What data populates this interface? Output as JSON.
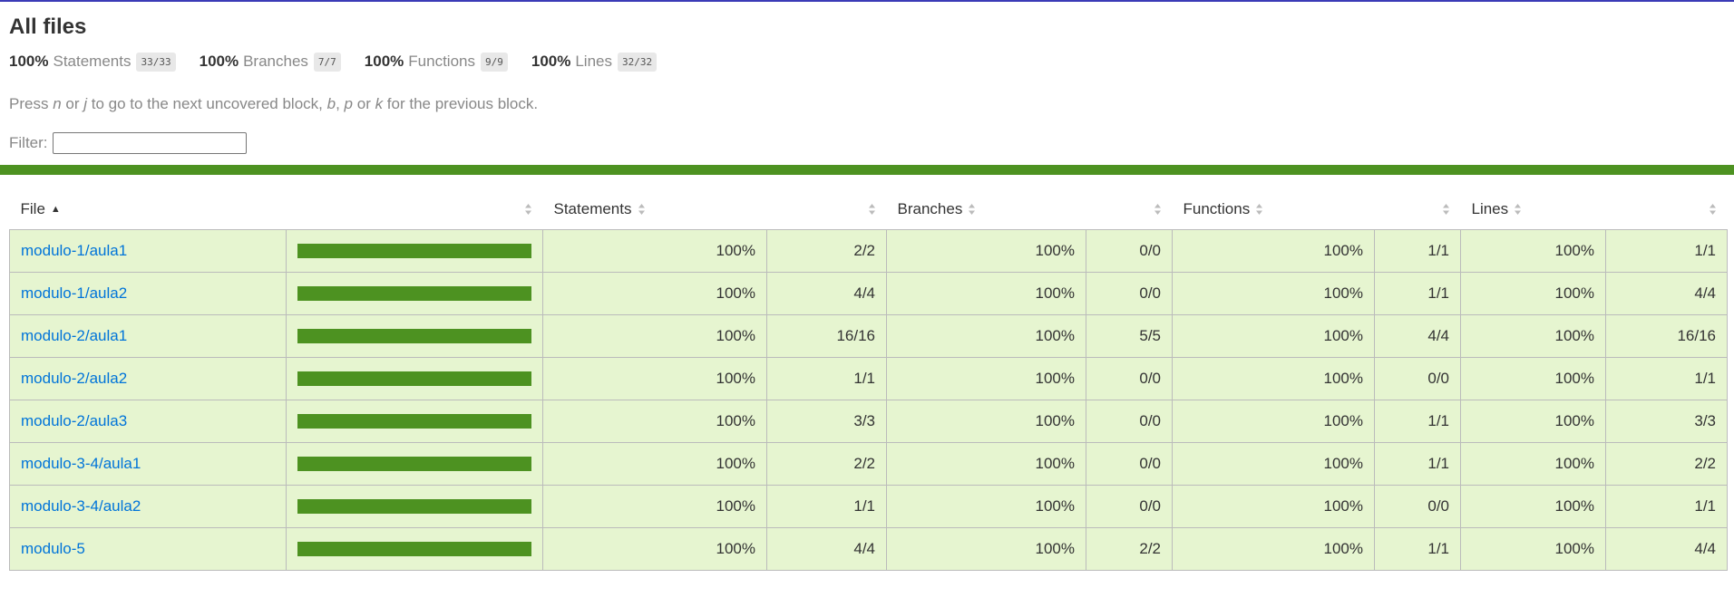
{
  "title": "All files",
  "summary": [
    {
      "pct": "100%",
      "label": "Statements",
      "fraction": "33/33"
    },
    {
      "pct": "100%",
      "label": "Branches",
      "fraction": "7/7"
    },
    {
      "pct": "100%",
      "label": "Functions",
      "fraction": "9/9"
    },
    {
      "pct": "100%",
      "label": "Lines",
      "fraction": "32/32"
    }
  ],
  "hint": {
    "press": "Press ",
    "key_n": "n",
    "or1": " or ",
    "key_j": "j",
    "middle": " to go to the next uncovered block, ",
    "key_b": "b",
    "comma": ", ",
    "key_p": "p",
    "or2": " or ",
    "key_k": "k",
    "end": " for the previous block."
  },
  "filter": {
    "label": "Filter:",
    "value": ""
  },
  "colors": {
    "status_bar": "#4d9221",
    "row_bg": "#e6f5d0",
    "link": "#0074d9"
  },
  "table": {
    "headers": {
      "file": "File",
      "statements": "Statements",
      "branches": "Branches",
      "functions": "Functions",
      "lines": "Lines"
    },
    "rows": [
      {
        "file": "modulo-1/aula1",
        "coverage": 1.0,
        "stmt_pct": "100%",
        "stmt_frac": "2/2",
        "br_pct": "100%",
        "br_frac": "0/0",
        "fn_pct": "100%",
        "fn_frac": "1/1",
        "ln_pct": "100%",
        "ln_frac": "1/1"
      },
      {
        "file": "modulo-1/aula2",
        "coverage": 1.0,
        "stmt_pct": "100%",
        "stmt_frac": "4/4",
        "br_pct": "100%",
        "br_frac": "0/0",
        "fn_pct": "100%",
        "fn_frac": "1/1",
        "ln_pct": "100%",
        "ln_frac": "4/4"
      },
      {
        "file": "modulo-2/aula1",
        "coverage": 1.0,
        "stmt_pct": "100%",
        "stmt_frac": "16/16",
        "br_pct": "100%",
        "br_frac": "5/5",
        "fn_pct": "100%",
        "fn_frac": "4/4",
        "ln_pct": "100%",
        "ln_frac": "16/16"
      },
      {
        "file": "modulo-2/aula2",
        "coverage": 1.0,
        "stmt_pct": "100%",
        "stmt_frac": "1/1",
        "br_pct": "100%",
        "br_frac": "0/0",
        "fn_pct": "100%",
        "fn_frac": "0/0",
        "ln_pct": "100%",
        "ln_frac": "1/1"
      },
      {
        "file": "modulo-2/aula3",
        "coverage": 1.0,
        "stmt_pct": "100%",
        "stmt_frac": "3/3",
        "br_pct": "100%",
        "br_frac": "0/0",
        "fn_pct": "100%",
        "fn_frac": "1/1",
        "ln_pct": "100%",
        "ln_frac": "3/3"
      },
      {
        "file": "modulo-3-4/aula1",
        "coverage": 1.0,
        "stmt_pct": "100%",
        "stmt_frac": "2/2",
        "br_pct": "100%",
        "br_frac": "0/0",
        "fn_pct": "100%",
        "fn_frac": "1/1",
        "ln_pct": "100%",
        "ln_frac": "2/2"
      },
      {
        "file": "modulo-3-4/aula2",
        "coverage": 1.0,
        "stmt_pct": "100%",
        "stmt_frac": "1/1",
        "br_pct": "100%",
        "br_frac": "0/0",
        "fn_pct": "100%",
        "fn_frac": "0/0",
        "ln_pct": "100%",
        "ln_frac": "1/1"
      },
      {
        "file": "modulo-5",
        "coverage": 1.0,
        "stmt_pct": "100%",
        "stmt_frac": "4/4",
        "br_pct": "100%",
        "br_frac": "2/2",
        "fn_pct": "100%",
        "fn_frac": "1/1",
        "ln_pct": "100%",
        "ln_frac": "4/4"
      }
    ]
  }
}
